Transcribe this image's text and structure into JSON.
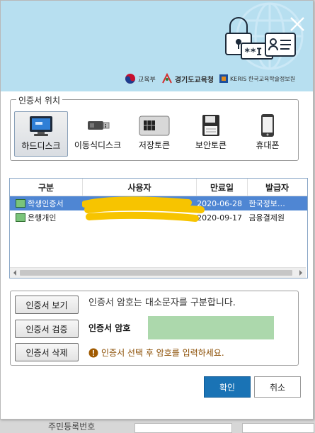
{
  "window": {
    "close_label": "✕"
  },
  "banner": {
    "logos": [
      {
        "name": "ministry",
        "text": "교육부"
      },
      {
        "name": "gyeonggi",
        "text": "경기도교육청"
      },
      {
        "name": "keris",
        "text": "KERIS 한국교육학술정보원"
      }
    ],
    "colors": {
      "banner_bg": "#b7dff0",
      "accent": "#1a73b5"
    }
  },
  "location": {
    "legend": "인증서 위치",
    "items": [
      {
        "id": "harddisk",
        "label": "하드디스크",
        "icon": "monitor-icon",
        "selected": true
      },
      {
        "id": "removable",
        "label": "이동식디스크",
        "icon": "usb-icon",
        "selected": false
      },
      {
        "id": "token",
        "label": "저장토큰",
        "icon": "chip-card-icon",
        "selected": false
      },
      {
        "id": "security",
        "label": "보안토큰",
        "icon": "floppy-icon",
        "selected": false
      },
      {
        "id": "phone",
        "label": "휴대폰",
        "icon": "phone-icon",
        "selected": false
      }
    ]
  },
  "table": {
    "columns": [
      "구분",
      "사용자",
      "만료일",
      "발급자"
    ],
    "rows": [
      {
        "type": "학생인증서",
        "user": "",
        "expiry": "2020-06-28",
        "issuer": "한국정보…",
        "selected": true
      },
      {
        "type": "은행개인",
        "user": "",
        "expiry": "2020-09-17",
        "issuer": "금융결제원",
        "selected": false
      }
    ]
  },
  "actions": {
    "view": "인증서 보기",
    "verify": "인증서 검증",
    "delete": "인증서 삭제",
    "case_note": "인증서 암호는 대소문자를 구분합니다.",
    "password_label": "인증서 암호",
    "password_value": "",
    "warning": "인증서 선택 후 암호를 입력하세요."
  },
  "buttons": {
    "ok": "확인",
    "cancel": "취소"
  },
  "background": {
    "label": "주민등록번호"
  }
}
